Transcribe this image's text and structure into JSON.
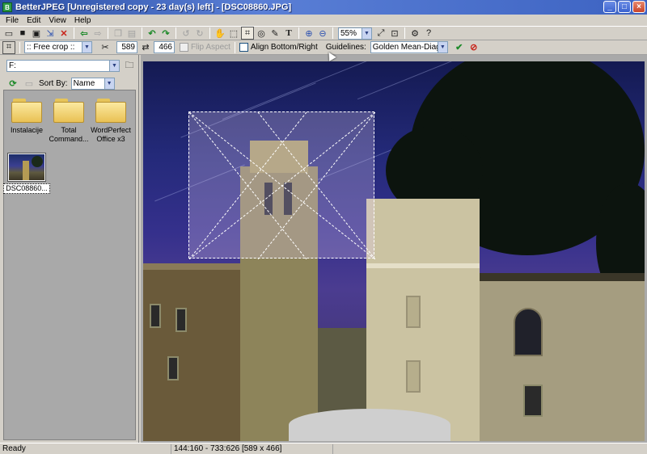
{
  "window": {
    "app_icon": "betterjpeg-app-icon",
    "title": "BetterJPEG [Unregistered copy - 23 day(s) left] - [DSC08860.JPG]",
    "buttons": {
      "minimize": "_",
      "maximize": "□",
      "close": "×"
    }
  },
  "menu": [
    "File",
    "Edit",
    "View",
    "Help"
  ],
  "toolbar": {
    "icons": [
      "open-icon",
      "save-icon",
      "save-as-icon",
      "export-icon",
      "delete-icon",
      "back-icon",
      "forward-icon",
      "copy-icon",
      "paste-icon",
      "rotate-left-icon",
      "rotate-right-icon",
      "undo-icon",
      "redo-icon",
      "hand-tool-icon",
      "select-tool-icon",
      "crop-tool-icon",
      "redeye-tool-icon",
      "clone-tool-icon",
      "text-tool-icon",
      "zoom-in-icon",
      "zoom-out-icon",
      "fit-icon",
      "actual-size-icon",
      "settings-icon",
      "help-icon"
    ],
    "zoom_value": "55%"
  },
  "crop_toolbar": {
    "crop_mode": ":: Free crop ::",
    "width": "589",
    "height": "466",
    "flip_aspect_label": "Flip Aspect",
    "align_label": "Align Bottom/Right",
    "guidelines_label": "Guidelines:",
    "guidelines_value": "Golden Mean-Diagonals",
    "apply_icon": "checkmark-icon",
    "cancel_icon": "cancel-icon"
  },
  "browser": {
    "drive": "F:",
    "sort_label": "Sort By:",
    "sort_value": "Name",
    "items": [
      {
        "label": "Instalacije",
        "type": "folder"
      },
      {
        "label": "Total Command...",
        "type": "folder"
      },
      {
        "label": "WordPerfect Office x3",
        "type": "folder"
      },
      {
        "label": "DSC08860...",
        "type": "image"
      }
    ]
  },
  "status": {
    "state": "Ready",
    "coords": "144:160 - 733:626 [589 x 466]"
  },
  "colors": {
    "titlebar": "#2b4fa5",
    "sky": "#35308c",
    "crop_fill": "#e1cdf0"
  }
}
